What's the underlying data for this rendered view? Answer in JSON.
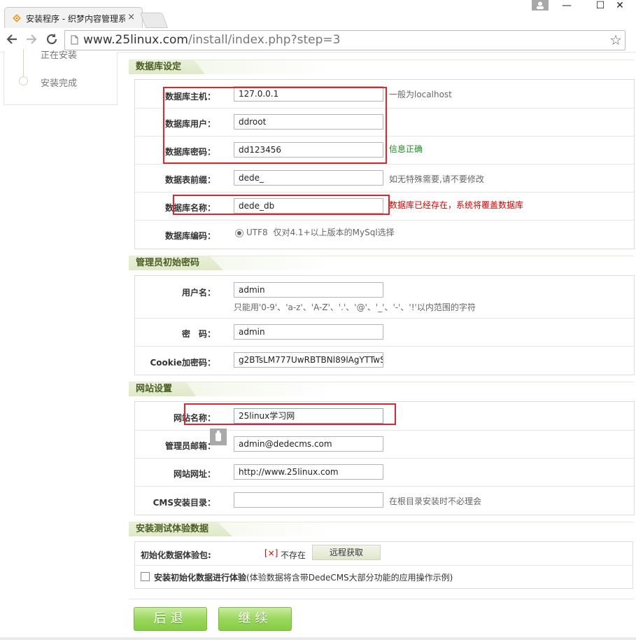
{
  "browser": {
    "tab_title": "安装程序 - 织梦内容管理系",
    "tab_close": "×",
    "url_host": "www.25linux.com",
    "url_path": "/install/index.php?step=3",
    "win_min": "—",
    "win_max": "☐",
    "win_close": "✕"
  },
  "sidebar": {
    "steps": [
      "正在安装",
      "安装完成"
    ]
  },
  "db_section": {
    "title": "数据库设定",
    "rows": [
      {
        "label": "数据库主机：",
        "value": "127.0.0.1",
        "hint": "一般为localhost"
      },
      {
        "label": "数据库用户：",
        "value": "ddroot",
        "hint": ""
      },
      {
        "label": "数据库密码：",
        "value": "dd123456",
        "hint": "信息正确"
      },
      {
        "label": "数据表前缀：",
        "value": "dede_",
        "hint": "如无特殊需要,请不要修改"
      },
      {
        "label": "数据库名称：",
        "value": "dede_db",
        "hint": "数据库已经存在，系统将覆盖数据库"
      },
      {
        "label": "数据库编码：",
        "value": "UTF8",
        "hint": "仅对4.1+以上版本的MySql选择"
      }
    ]
  },
  "admin_section": {
    "title": "管理员初始密码",
    "rows": [
      {
        "label": "用户名：",
        "value": "admin",
        "hint": "只能用'0-9'、'a-z'、'A-Z'、'.'、'@'、'_'、'-'、'!'以内范围的字符"
      },
      {
        "label": "密　码：",
        "value": "admin"
      },
      {
        "label": "Cookie加密码：",
        "value": "g2BTsLM777UwRBTBNl89lAgYTTwS"
      }
    ]
  },
  "site_section": {
    "title": "网站设置",
    "rows": [
      {
        "label": "网站名称：",
        "value": "25linux学习网"
      },
      {
        "label": "管理员邮箱：",
        "value": "admin@dedecms.com"
      },
      {
        "label": "网站网址：",
        "value": "http://www.25linux.com"
      },
      {
        "label": "CMS安装目录：",
        "value": "",
        "hint": "在根目录安装时不必理会"
      }
    ]
  },
  "demo_section": {
    "title": "安装测试体验数据",
    "pkg_label": "初始化数据体验包:",
    "pkg_status_mark": "[×]",
    "pkg_status": "不存在",
    "remote_button": "远程获取",
    "install_demo_label": "安装初始化数据进行体验",
    "install_demo_note": "(体验数据将含带DedeCMS大部分功能的应用操作示例)"
  },
  "buttons": {
    "back": "后退",
    "continue": "继续"
  },
  "colors": {
    "accent_green": "#86cc45",
    "error_red": "#d40000",
    "ok_green": "#1e8a1e",
    "highlight_box": "#e5232c"
  }
}
